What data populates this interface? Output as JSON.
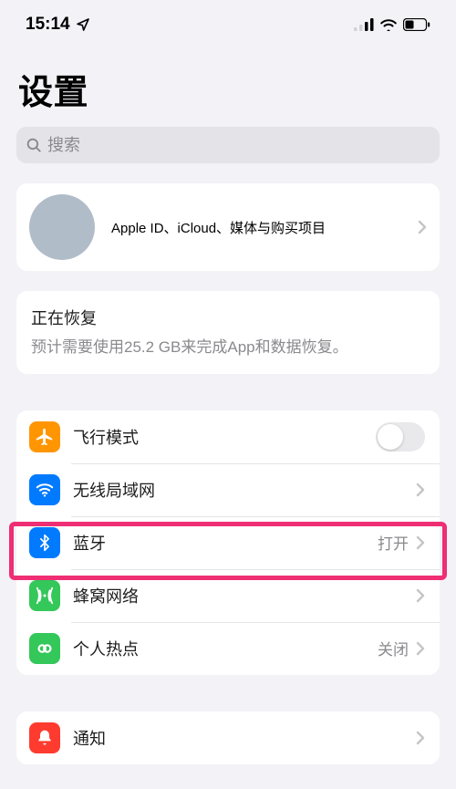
{
  "status": {
    "time": "15:14"
  },
  "page": {
    "title": "设置"
  },
  "search": {
    "placeholder": "搜索"
  },
  "profile": {
    "subtitle": "Apple ID、iCloud、媒体与购买项目"
  },
  "restore": {
    "title": "正在恢复",
    "description": "预计需要使用25.2 GB来完成App和数据恢复。"
  },
  "network": {
    "airplane": {
      "label": "飞行模式"
    },
    "wifi": {
      "label": "无线局域网",
      "value": ""
    },
    "bluetooth": {
      "label": "蓝牙",
      "value": "打开"
    },
    "cellular": {
      "label": "蜂窝网络"
    },
    "hotspot": {
      "label": "个人热点",
      "value": "关闭"
    }
  },
  "notifications": {
    "label": "通知"
  }
}
